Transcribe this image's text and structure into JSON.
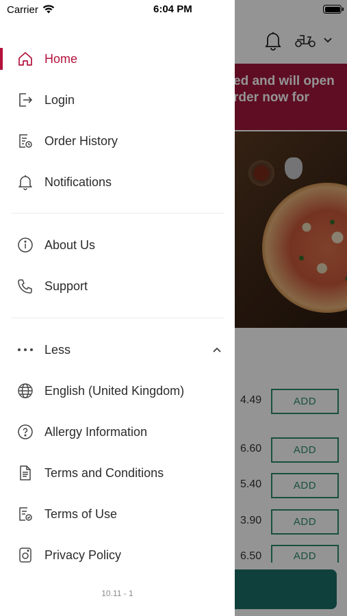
{
  "status_bar": {
    "carrier": "Carrier",
    "time": "6:04 PM"
  },
  "background": {
    "banner_lines": [
      "ed and will open",
      "rder now for"
    ],
    "prices": [
      "4.49",
      "6.60",
      "5.40",
      "3.90",
      "6.50"
    ],
    "add_label": "ADD"
  },
  "menu": {
    "primary": [
      {
        "label": "Home",
        "icon": "home-icon",
        "active": true
      },
      {
        "label": "Login",
        "icon": "login-icon"
      },
      {
        "label": "Order History",
        "icon": "order-history-icon"
      },
      {
        "label": "Notifications",
        "icon": "bell-icon"
      }
    ],
    "secondary": [
      {
        "label": "About Us",
        "icon": "info-icon"
      },
      {
        "label": "Support",
        "icon": "phone-icon"
      }
    ],
    "less_label": "Less",
    "more": [
      {
        "label": "English (United Kingdom)",
        "icon": "globe-icon"
      },
      {
        "label": "Allergy Information",
        "icon": "question-icon"
      },
      {
        "label": "Terms and Conditions",
        "icon": "document-icon"
      },
      {
        "label": "Terms of Use",
        "icon": "document-check-icon"
      },
      {
        "label": "Privacy Policy",
        "icon": "privacy-icon"
      }
    ]
  },
  "version": "10.11 - 1",
  "colors": {
    "accent": "#b3123b",
    "banner": "#a3183c",
    "add_button": "#2a8a66",
    "cart_bar": "#1d6f68"
  }
}
